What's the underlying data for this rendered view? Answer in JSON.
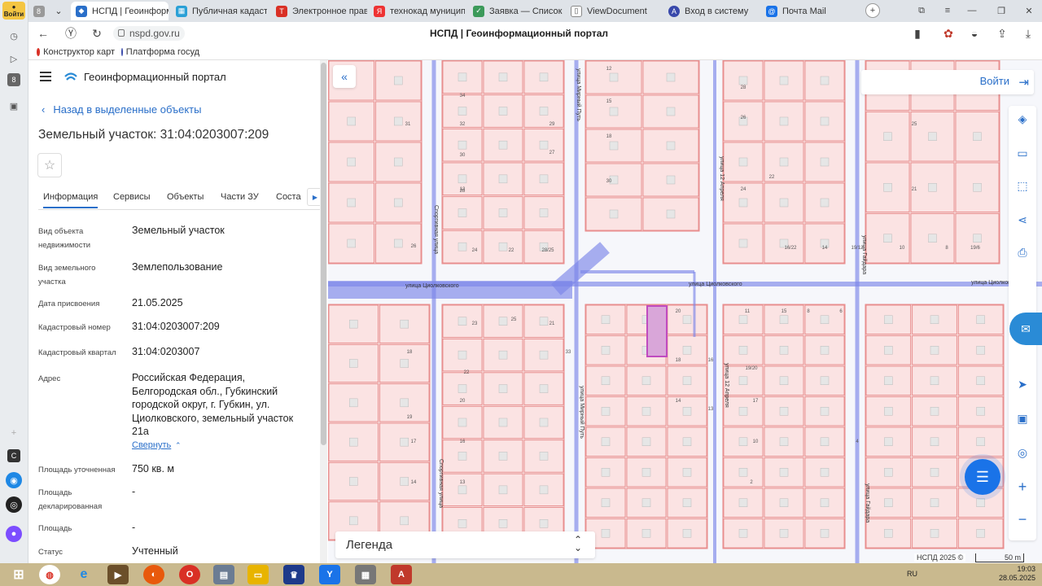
{
  "browser": {
    "profile_label": "Войти",
    "tabs": [
      {
        "title": "НСПД | Геоинформ",
        "active": true,
        "color": "#2a6fc9"
      },
      {
        "title": "Публичная кадастр",
        "color": "#2aa0d6"
      },
      {
        "title": "Электронное прави",
        "color": "#d93025"
      },
      {
        "title": "технокад муниципа",
        "color": "#e33"
      },
      {
        "title": "Заявка — Список за",
        "color": "#3c9a5a"
      },
      {
        "title": "ViewDocument",
        "color": "#777"
      },
      {
        "title": "Вход в систему",
        "color": "#3949ab"
      },
      {
        "title": "Почта Mail",
        "color": "#1a73e8"
      }
    ],
    "url": "nspd.gov.ru",
    "page_title": "НСПД | Геоинформационный портал",
    "bookmarks": [
      "Конструктор карт",
      "Платформа госуд"
    ]
  },
  "panel": {
    "portal_name": "Геоинформационный портал",
    "back_label": "Назад в выделенные объекты",
    "object_title": "Земельный участок: 31:04:0203007:209",
    "tabs": [
      "Информация",
      "Сервисы",
      "Объекты",
      "Части ЗУ",
      "Соста"
    ],
    "properties": [
      {
        "label": "Вид объекта недвижимости",
        "value": "Земельный участок"
      },
      {
        "label": "Вид земельного участка",
        "value": "Землепользование"
      },
      {
        "label": "Дата присвоения",
        "value": "21.05.2025"
      },
      {
        "label": "Кадастровый номер",
        "value": "31:04:0203007:209"
      },
      {
        "label": "Кадастровый квартал",
        "value": "31:04:0203007"
      },
      {
        "label": "Адрес",
        "value": "Российская Федерация, Белгородская обл., Губкинский городской округ, г. Губкин, ул. Циолковского, земельный участок 21а"
      },
      {
        "label": "Площадь уточненная",
        "value": "750 кв. м"
      },
      {
        "label": "Площадь декларированная",
        "value": "-"
      },
      {
        "label": "Площадь",
        "value": "-"
      },
      {
        "label": "Статус",
        "value": "Учтенный"
      }
    ],
    "collapse_label": "Свернуть"
  },
  "map": {
    "login_label": "Войти",
    "legend_label": "Легенда",
    "copyright": "НСПД 2025 ©",
    "scale_label": "50 m",
    "streets": [
      "улица Циолковского",
      "улица Циолковского",
      "улица Циолковского",
      "улица 12 Апреля",
      "улица 12 Апреля",
      "Спортивная улица",
      "Спортивная улица",
      "улица Гайдара",
      "улица Гайдара",
      "улица Мирный Путь",
      "улица Мирный Путь",
      "улица Котлярова"
    ],
    "parcel_numbers": [
      "34",
      "32",
      "30",
      "31",
      "12",
      "29",
      "27",
      "28",
      "26",
      "24",
      "22",
      "28/25",
      "18",
      "33",
      "23",
      "25",
      "21",
      "22",
      "19",
      "20",
      "17",
      "16",
      "14",
      "13",
      "12",
      "15",
      "18",
      "30",
      "28",
      "26",
      "24",
      "22",
      "16/22",
      "14",
      "19/12",
      "10",
      "8",
      "19/6",
      "27",
      "25",
      "21",
      "20",
      "18",
      "16",
      "14",
      "13",
      "11",
      "15",
      "19/20",
      "17",
      "10",
      "8",
      "6",
      "4",
      "2"
    ],
    "highlight_color": "#c04bc0"
  },
  "taskbar": {
    "lang": "RU",
    "time": "19:03",
    "date": "28.05.2025"
  }
}
